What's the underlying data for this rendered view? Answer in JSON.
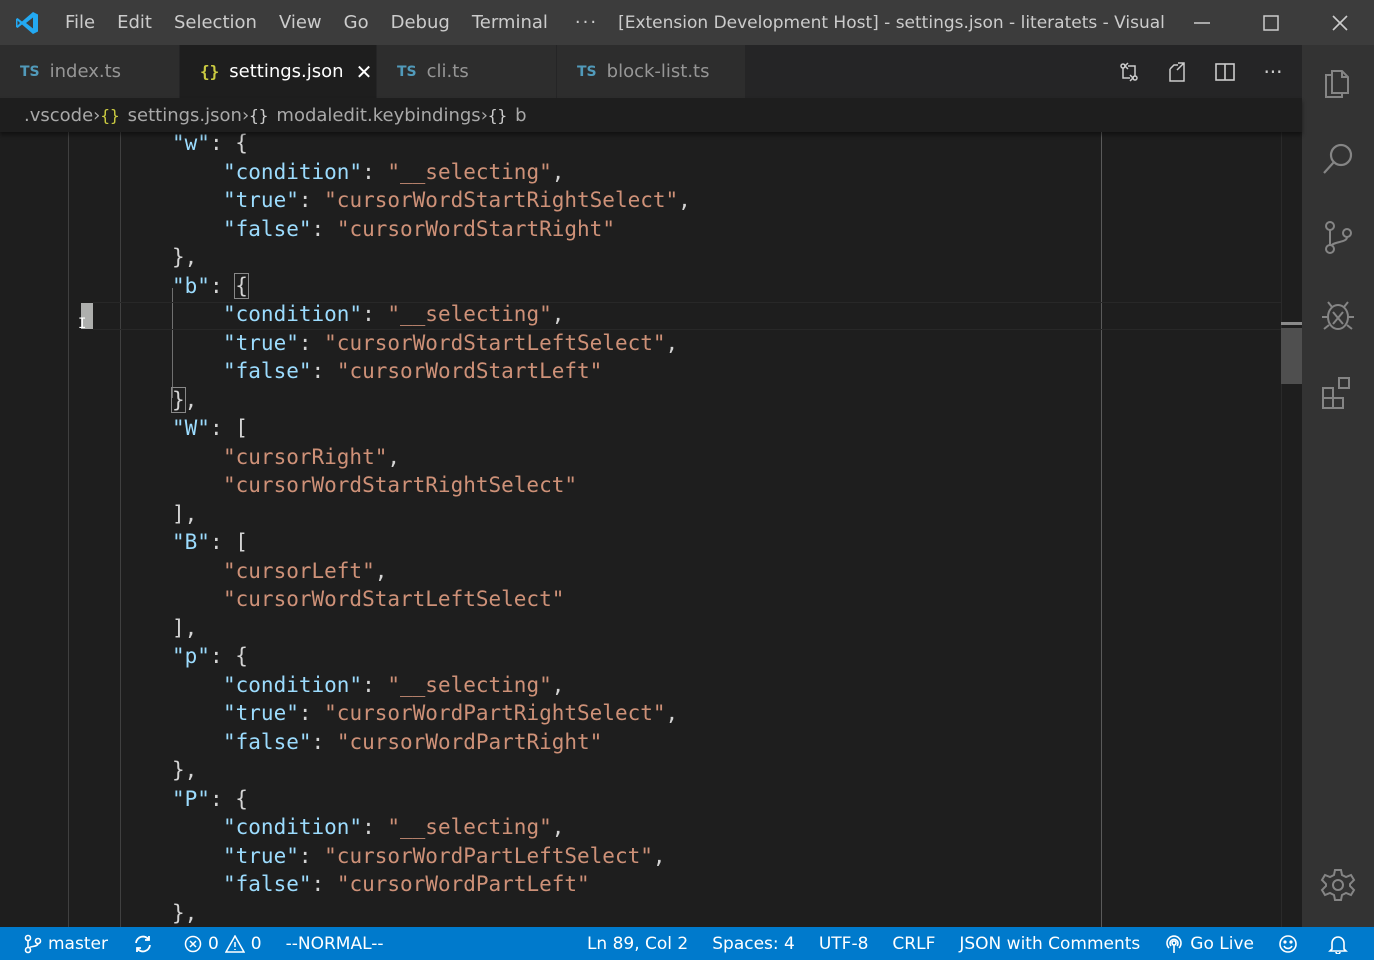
{
  "titlebar": {
    "menu": [
      "File",
      "Edit",
      "Selection",
      "View",
      "Go",
      "Debug",
      "Terminal"
    ],
    "more": "···",
    "title": "[Extension Development Host] - settings.json - literatets - Visual Stu..."
  },
  "tabs": [
    {
      "badge": "TS",
      "label": "index.ts"
    },
    {
      "badge": "{}",
      "label": "settings.json",
      "close": "✕"
    },
    {
      "badge": "TS",
      "label": "cli.ts"
    },
    {
      "badge": "TS",
      "label": "block-list.ts"
    }
  ],
  "tab_actions": {
    "more": "···"
  },
  "breadcrumb": {
    "folder": ".vscode",
    "file_icon": "{}",
    "file": "settings.json",
    "obj_icon": "{}",
    "section": "modaledit.keybindings",
    "obj_icon2": "{}",
    "leaf": "b",
    "sep": "›"
  },
  "code": {
    "l1": {
      "key": "\"w\"",
      "rest": ": {"
    },
    "l2": {
      "key": "\"condition\"",
      "val": "\"__selecting\""
    },
    "l3": {
      "key": "\"true\"",
      "val": "\"cursorWordStartRightSelect\""
    },
    "l4": {
      "key": "\"false\"",
      "val": "\"cursorWordStartRight\""
    },
    "l5": {
      "text": "},"
    },
    "l6": {
      "key": "\"b\"",
      "colon": ": ",
      "brace": "{"
    },
    "l7": {
      "key": "\"condition\"",
      "val": "\"__selecting\""
    },
    "l8": {
      "key": "\"true\"",
      "val": "\"cursorWordStartLeftSelect\""
    },
    "l9": {
      "key": "\"false\"",
      "val": "\"cursorWordStartLeft\""
    },
    "l10": {
      "brace": "}",
      "rest": ","
    },
    "l11": {
      "key": "\"W\"",
      "rest": ": ["
    },
    "l12": {
      "val": "\"cursorRight\""
    },
    "l13": {
      "val": "\"cursorWordStartRightSelect\""
    },
    "l14": {
      "text": "],"
    },
    "l15": {
      "key": "\"B\"",
      "rest": ": ["
    },
    "l16": {
      "val": "\"cursorLeft\""
    },
    "l17": {
      "val": "\"cursorWordStartLeftSelect\""
    },
    "l18": {
      "text": "],"
    },
    "l19": {
      "key": "\"p\"",
      "rest": ": {"
    },
    "l20": {
      "key": "\"condition\"",
      "val": "\"__selecting\""
    },
    "l21": {
      "key": "\"true\"",
      "val": "\"cursorWordPartRightSelect\""
    },
    "l22": {
      "key": "\"false\"",
      "val": "\"cursorWordPartRight\""
    },
    "l23": {
      "text": "},"
    },
    "l24": {
      "key": "\"P\"",
      "rest": ": {"
    },
    "l25": {
      "key": "\"condition\"",
      "val": "\"__selecting\""
    },
    "l26": {
      "key": "\"true\"",
      "val": "\"cursorWordPartLeftSelect\""
    },
    "l27": {
      "key": "\"false\"",
      "val": "\"cursorWordPartLeft\""
    },
    "l28": {
      "text": "},"
    }
  },
  "statusbar": {
    "branch": "master",
    "errors": "0",
    "warnings": "0",
    "mode": "--NORMAL--",
    "position": "Ln 89, Col 2",
    "spaces": "Spaces: 4",
    "encoding": "UTF-8",
    "eol": "CRLF",
    "language": "JSON with Comments",
    "golive": "Go Live"
  },
  "colors": {
    "statusbar": "#007acc",
    "key": "#9cdcfe",
    "string": "#ce9178",
    "accent": "#0078d4"
  },
  "icons": {
    "activity": [
      "explorer-icon",
      "search-icon",
      "source-control-icon",
      "debug-icon",
      "extensions-icon",
      "settings-gear-icon"
    ]
  }
}
